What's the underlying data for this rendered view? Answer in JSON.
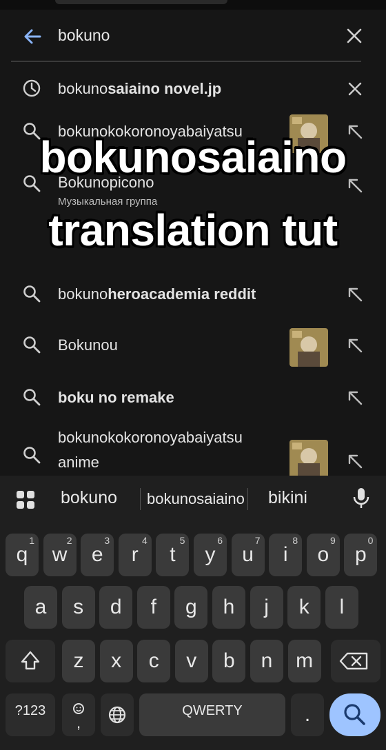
{
  "search": {
    "query": "bokuno"
  },
  "suggestions": [
    {
      "kind": "history",
      "parts": [
        {
          "t": "bokuno",
          "b": false
        },
        {
          "t": "saiaino novel.jp",
          "b": true
        }
      ],
      "trail": "close"
    },
    {
      "kind": "search",
      "parts": [
        {
          "t": "bokunokokoronoyabaiyatsu",
          "b": false
        }
      ],
      "trail": "arrow",
      "thumb": true
    },
    {
      "kind": "search",
      "parts": [
        {
          "t": "Bokunopicono",
          "b": false
        }
      ],
      "sub": "Музыкальная группа",
      "trail": "arrow"
    },
    {
      "kind": "search",
      "parts": [
        {
          "t": "bokuno",
          "b": false
        },
        {
          "t": "heroacademia reddit",
          "b": true
        }
      ],
      "trail": "arrow"
    },
    {
      "kind": "search",
      "parts": [
        {
          "t": "Bokunou",
          "b": false
        }
      ],
      "trail": "arrow",
      "thumb": true
    },
    {
      "kind": "search",
      "parts": [
        {
          "t": "boku no remake",
          "b": true
        }
      ],
      "trail": "arrow"
    },
    {
      "kind": "search",
      "parts": [
        {
          "t": "bokunokokoronoyabaiyatsu",
          "b": false
        }
      ],
      "line2": "anime",
      "trail": "arrow",
      "thumb": true
    }
  ],
  "overlay": {
    "line1": "bokunosaiaino",
    "line2": "translation tut"
  },
  "keyboard": {
    "predictions": [
      "bokuno",
      "bokunosaiaino",
      "bikini"
    ],
    "row1": [
      {
        "k": "q",
        "h": "1"
      },
      {
        "k": "w",
        "h": "2"
      },
      {
        "k": "e",
        "h": "3"
      },
      {
        "k": "r",
        "h": "4"
      },
      {
        "k": "t",
        "h": "5"
      },
      {
        "k": "y",
        "h": "6"
      },
      {
        "k": "u",
        "h": "7"
      },
      {
        "k": "i",
        "h": "8"
      },
      {
        "k": "o",
        "h": "9"
      },
      {
        "k": "p",
        "h": "0"
      }
    ],
    "row2": [
      "a",
      "s",
      "d",
      "f",
      "g",
      "h",
      "j",
      "k",
      "l"
    ],
    "row3": [
      "z",
      "x",
      "c",
      "v",
      "b",
      "n",
      "m"
    ],
    "symbols_label": "?123",
    "space_label": "QWERTY",
    "comma_label": ",",
    "period_label": "."
  },
  "colors": {
    "background": "#161616",
    "keyboard": "#1f1f1f",
    "key": "#3a3a3a",
    "search_key": "#9ec4ff",
    "accent_back": "#8ab4f8"
  }
}
